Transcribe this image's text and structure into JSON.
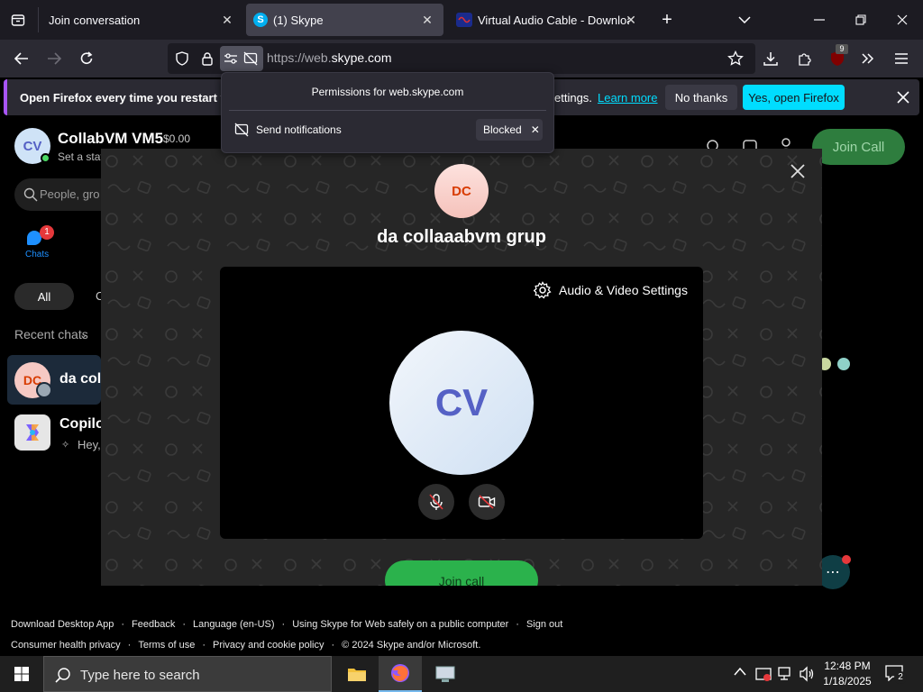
{
  "browser": {
    "tabs": [
      {
        "title": "Join conversation",
        "active": false
      },
      {
        "title": "(1) Skype",
        "active": true
      },
      {
        "title": "Virtual Audio Cable - Download",
        "active": false
      }
    ],
    "url_prefix": "https://web.",
    "url_domain": "skype.com",
    "extension_badge": "9"
  },
  "notification_bar": {
    "message_start": "Open Firefox every time you restart your",
    "message_end": "ettings.",
    "learn_more": "Learn more",
    "no_thanks": "No thanks",
    "yes_open": "Yes, open Firefox"
  },
  "permissions_popup": {
    "title": "Permissions for web.skype.com",
    "item_label": "Send notifications",
    "item_state": "Blocked"
  },
  "skype": {
    "profile_initials": "CV",
    "profile_name": "CollabVM VM5",
    "balance": "$0.00",
    "status_placeholder": "Set a stat",
    "search_placeholder": "People, gro",
    "nav_chats": "Chats",
    "chats_badge": "1",
    "filter_all": "All",
    "filter_other": "C",
    "recent_chats": "Recent chats",
    "chat_items": [
      {
        "initials": "DC",
        "name": "da coll",
        "snippet": ""
      },
      {
        "initials": "",
        "name": "Copilo",
        "snippet": "Hey,"
      }
    ],
    "join_call_header": "Join Call"
  },
  "call_panel": {
    "group_initials": "DC",
    "group_name": "da collaaabvm grup",
    "settings_label": "Audio & Video Settings",
    "self_initials": "CV",
    "join_call": "Join call"
  },
  "footer": {
    "links_row1": [
      "Download Desktop App",
      "Feedback",
      "Language (en-US)",
      "Using Skype for Web safely on a public computer",
      "Sign out"
    ],
    "links_row2": [
      "Consumer health privacy",
      "Terms of use",
      "Privacy and cookie policy"
    ],
    "copyright": "© 2024 Skype and/or Microsoft."
  },
  "taskbar": {
    "search_placeholder": "Type here to search",
    "time": "12:48 PM",
    "date": "1/18/2025",
    "notification_count": "2"
  },
  "colors": {
    "accent_cyan": "#00ddff",
    "skype_green": "#4cd964",
    "firefox_purple": "#a855f7",
    "avatar_cv_text": "#5561c5",
    "avatar_dc_text": "#d83b01"
  }
}
